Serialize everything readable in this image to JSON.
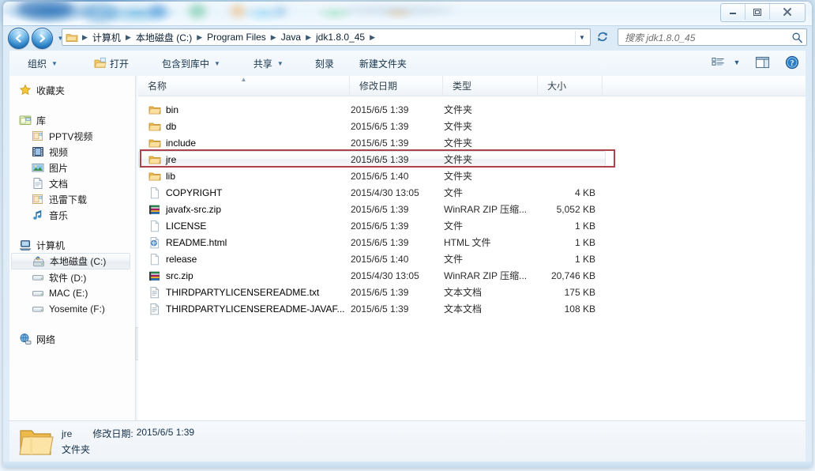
{
  "window": {
    "controls": {
      "minimize": "minimize-button",
      "maximize": "maximize-button",
      "close": "close-button"
    }
  },
  "address_bar": {
    "back_label": "后退",
    "forward_label": "前进",
    "recent_dropdown_label": "最近访问的位置",
    "breadcrumbs": [
      "计算机",
      "本地磁盘 (C:)",
      "Program Files",
      "Java",
      "jdk1.8.0_45"
    ],
    "separator": "▶",
    "refresh_label": "刷新",
    "dropdown_label": "▼"
  },
  "search": {
    "placeholder": "搜索 jdk1.8.0_45",
    "value": "",
    "icon": "search-icon"
  },
  "toolbar": {
    "items": [
      {
        "label": "组织",
        "has_caret": true,
        "icon": null
      },
      {
        "label": "打开",
        "has_caret": false,
        "icon": "open-folder-icon"
      },
      {
        "label": "包含到库中",
        "has_caret": true,
        "icon": null
      },
      {
        "label": "共享",
        "has_caret": true,
        "icon": null
      },
      {
        "label": "刻录",
        "has_caret": false,
        "icon": null
      },
      {
        "label": "新建文件夹",
        "has_caret": false,
        "icon": null
      }
    ],
    "view_options_label": "更改您的视图",
    "preview_pane_label": "显示预览窗格",
    "help_label": "获取帮助"
  },
  "sidebar": {
    "groups": [
      {
        "header": {
          "label": "收藏夹",
          "icon": "star-icon"
        },
        "children": []
      },
      {
        "header": {
          "label": "库",
          "icon": "library-icon"
        },
        "children": [
          {
            "label": "PPTV视频",
            "icon": "library-item-icon"
          },
          {
            "label": "视频",
            "icon": "video-icon"
          },
          {
            "label": "图片",
            "icon": "pictures-icon"
          },
          {
            "label": "文档",
            "icon": "documents-icon"
          },
          {
            "label": "迅雷下载",
            "icon": "library-item-icon"
          },
          {
            "label": "音乐",
            "icon": "music-icon"
          }
        ]
      },
      {
        "header": {
          "label": "计算机",
          "icon": "computer-icon"
        },
        "children": [
          {
            "label": "本地磁盘 (C:)",
            "icon": "system-drive-icon",
            "selected": true
          },
          {
            "label": "软件 (D:)",
            "icon": "drive-icon"
          },
          {
            "label": "MAC (E:)",
            "icon": "drive-icon"
          },
          {
            "label": "Yosemite (F:)",
            "icon": "drive-icon"
          }
        ]
      },
      {
        "header": {
          "label": "网络",
          "icon": "network-icon"
        },
        "children": []
      }
    ]
  },
  "file_list": {
    "columns": [
      {
        "key": "name",
        "label": "名称",
        "sorted": "asc"
      },
      {
        "key": "date",
        "label": "修改日期",
        "sorted": null
      },
      {
        "key": "type",
        "label": "类型",
        "sorted": null
      },
      {
        "key": "size",
        "label": "大小",
        "sorted": null
      }
    ],
    "rows": [
      {
        "name": "bin",
        "date": "2015/6/5 1:39",
        "type": "文件夹",
        "size": "",
        "icon": "folder-icon"
      },
      {
        "name": "db",
        "date": "2015/6/5 1:39",
        "type": "文件夹",
        "size": "",
        "icon": "folder-icon"
      },
      {
        "name": "include",
        "date": "2015/6/5 1:39",
        "type": "文件夹",
        "size": "",
        "icon": "folder-icon"
      },
      {
        "name": "jre",
        "date": "2015/6/5 1:39",
        "type": "文件夹",
        "size": "",
        "icon": "folder-icon",
        "highlighted": true,
        "annotated": true
      },
      {
        "name": "lib",
        "date": "2015/6/5 1:40",
        "type": "文件夹",
        "size": "",
        "icon": "folder-icon"
      },
      {
        "name": "COPYRIGHT",
        "date": "2015/4/30 13:05",
        "type": "文件",
        "size": "4 KB",
        "icon": "blank-file-icon"
      },
      {
        "name": "javafx-src.zip",
        "date": "2015/6/5 1:39",
        "type": "WinRAR ZIP 压缩...",
        "size": "5,052 KB",
        "icon": "winrar-zip-icon"
      },
      {
        "name": "LICENSE",
        "date": "2015/6/5 1:39",
        "type": "文件",
        "size": "1 KB",
        "icon": "blank-file-icon"
      },
      {
        "name": "README.html",
        "date": "2015/6/5 1:39",
        "type": "HTML 文件",
        "size": "1 KB",
        "icon": "html-file-icon"
      },
      {
        "name": "release",
        "date": "2015/6/5 1:40",
        "type": "文件",
        "size": "1 KB",
        "icon": "blank-file-icon"
      },
      {
        "name": "src.zip",
        "date": "2015/4/30 13:05",
        "type": "WinRAR ZIP 压缩...",
        "size": "20,746 KB",
        "icon": "winrar-zip-icon"
      },
      {
        "name": "THIRDPARTYLICENSEREADME.txt",
        "date": "2015/6/5 1:39",
        "type": "文本文档",
        "size": "175 KB",
        "icon": "text-file-icon"
      },
      {
        "name": "THIRDPARTYLICENSEREADME-JAVAF...",
        "date": "2015/6/5 1:39",
        "type": "文本文档",
        "size": "108 KB",
        "icon": "text-file-icon"
      }
    ]
  },
  "status_bar": {
    "item_name": "jre",
    "date_label": "修改日期:",
    "date_value": "2015/6/5 1:39",
    "item_type": "文件夹",
    "icon": "large-folder-icon"
  },
  "colors": {
    "annotation": "#b0414b",
    "accent": "#2a7fc4",
    "folder": "#f5c762",
    "chrome": "#dcecf7"
  }
}
